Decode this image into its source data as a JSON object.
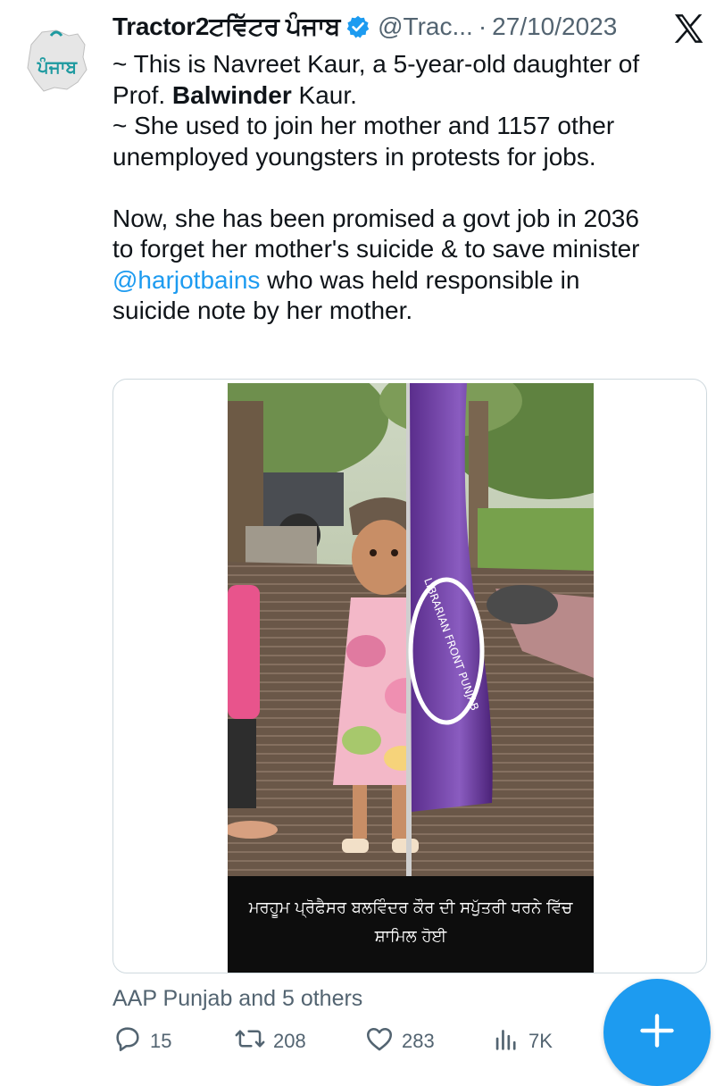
{
  "author": {
    "name": "Tractor2ਟਵਿੱਟਰ ਪੰਜਾਬ",
    "handle": "@Trac...",
    "separator": "·",
    "date": "27/10/2023",
    "avatar_text": "ਪੰਜਾਬ"
  },
  "tweet": {
    "line1": "~ This is Navreet Kaur, a 5-year-old daughter of",
    "line2_prefix": "Prof. ",
    "line2_bold": "Balwinder",
    "line2_suffix": " Kaur.",
    "line3": "~ She used to join her mother and 1157 other",
    "line4": "unemployed youngsters in protests for jobs.",
    "line5": "Now, she has been promised a govt job in 2036",
    "line6": "to forget her mother's suicide & to save minister",
    "mention": "@harjotbains",
    "line7_suffix": " who was held responsible in",
    "line8": "suicide note by her mother."
  },
  "media": {
    "caption_line1": "ਮਰਹੂਮ ਪ੍ਰੋਫੈਸਰ ਬਲਵਿੰਦਰ ਕੌਰ ਦੀ ਸਪੁੱਤਰੀ ਧਰਨੇ ਵਿੱਚ",
    "caption_line2": "ਸ਼ਾਮਿਲ ਹੋਈ",
    "flag_text": "LIBRARIAN FRONT PUNJAB"
  },
  "social": {
    "liked_by": "AAP Punjab and 5 others",
    "replies": "15",
    "reposts": "208",
    "likes": "283",
    "views": "7K"
  },
  "colors": {
    "accent": "#1d9bf0",
    "secondary_text": "#536471",
    "primary_text": "#0f1419",
    "border": "#cfd9de"
  },
  "icons": [
    "verified-badge-icon",
    "x-logo-icon",
    "reply-icon",
    "repost-icon",
    "like-icon",
    "views-icon",
    "plus-icon"
  ]
}
